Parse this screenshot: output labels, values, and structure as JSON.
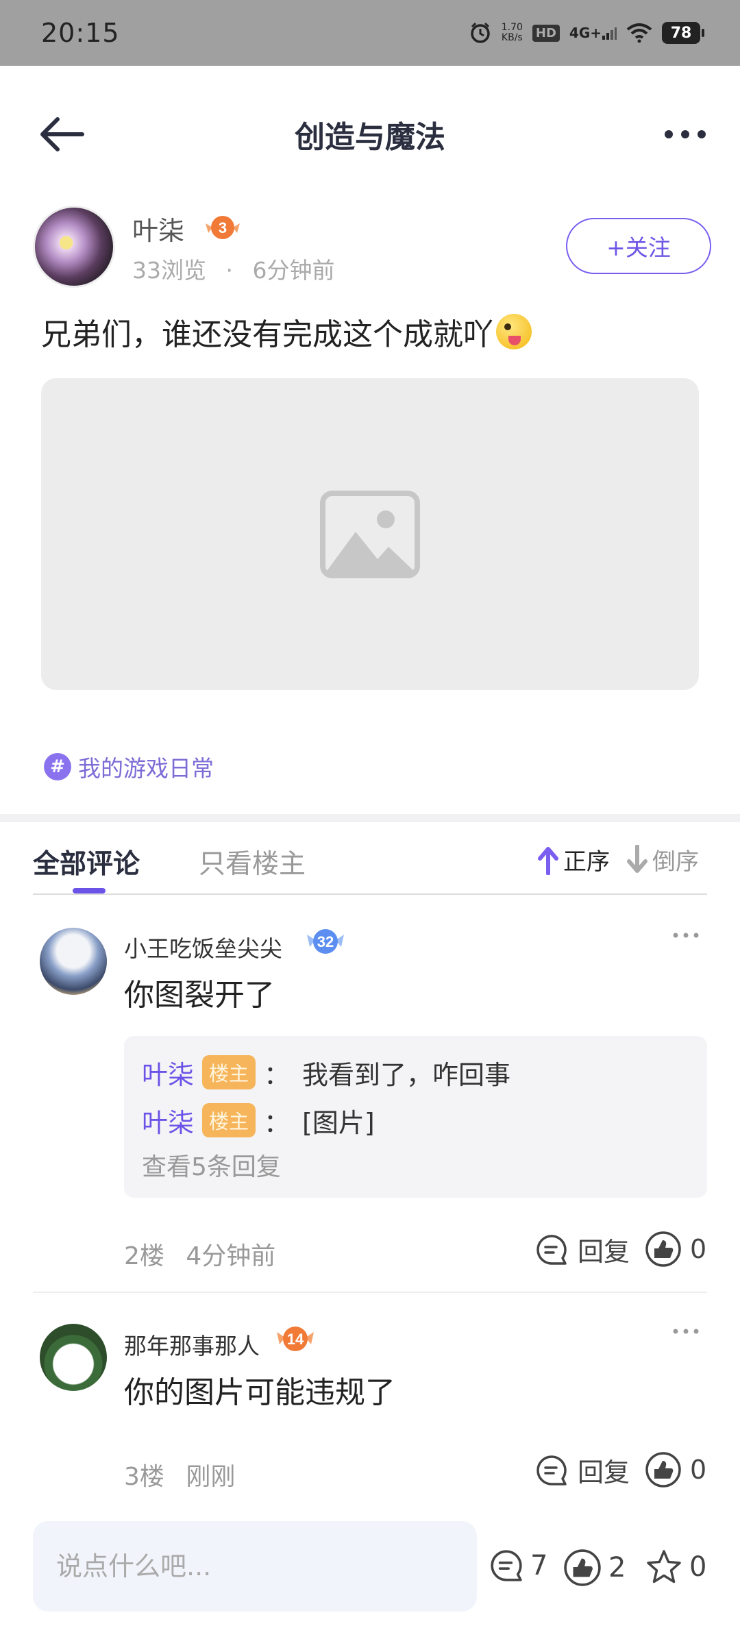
{
  "status_bar": {
    "time": "20:15",
    "speed_value": "1.70",
    "speed_unit": "KB/s",
    "hd": "HD",
    "network": "4G+",
    "battery": "78"
  },
  "header": {
    "title": "创造与魔法",
    "back_icon": "arrow-left-icon",
    "more_icon": "more-dots-icon"
  },
  "post": {
    "author": {
      "name": "叶柒",
      "level": "3",
      "views": "33浏览",
      "separator": "·",
      "time": "6分钟前",
      "follow_label": "+关注"
    },
    "text": "兄弟们，谁还没有完成这个成就吖",
    "image_icon": "image-placeholder-icon",
    "topic": "我的游戏日常",
    "topic_icon": "hash-icon"
  },
  "comment_tabs": {
    "all": "全部评论",
    "owner_only": "只看楼主",
    "sort_asc": "正序",
    "sort_desc": "倒序"
  },
  "comments": [
    {
      "name": "小王吃饭垒尖尖",
      "level": "32",
      "text": "你图裂开了",
      "replies": [
        {
          "author": "叶柒",
          "tag": "楼主",
          "colon": "：",
          "content": "我看到了，咋回事"
        },
        {
          "author": "叶柒",
          "tag": "楼主",
          "colon": "：",
          "content": "[图片]"
        }
      ],
      "more_replies": "查看5条回复",
      "floor": "2楼",
      "time": "4分钟前",
      "reply_label": "回复",
      "likes": "0"
    },
    {
      "name": "那年那事那人",
      "level": "14",
      "text": "你的图片可能违规了",
      "floor": "3楼",
      "time": "刚刚",
      "reply_label": "回复",
      "likes": "0"
    }
  ],
  "bottom_bar": {
    "input_placeholder": "说点什么吧...",
    "comments_count": "7",
    "likes_count": "2",
    "favorites_count": "0"
  },
  "colors": {
    "accent": "#6c53e8",
    "owner_tag": "#f6b55a",
    "level_orange": "#f07a36",
    "level_blue": "#5b8ef0"
  }
}
